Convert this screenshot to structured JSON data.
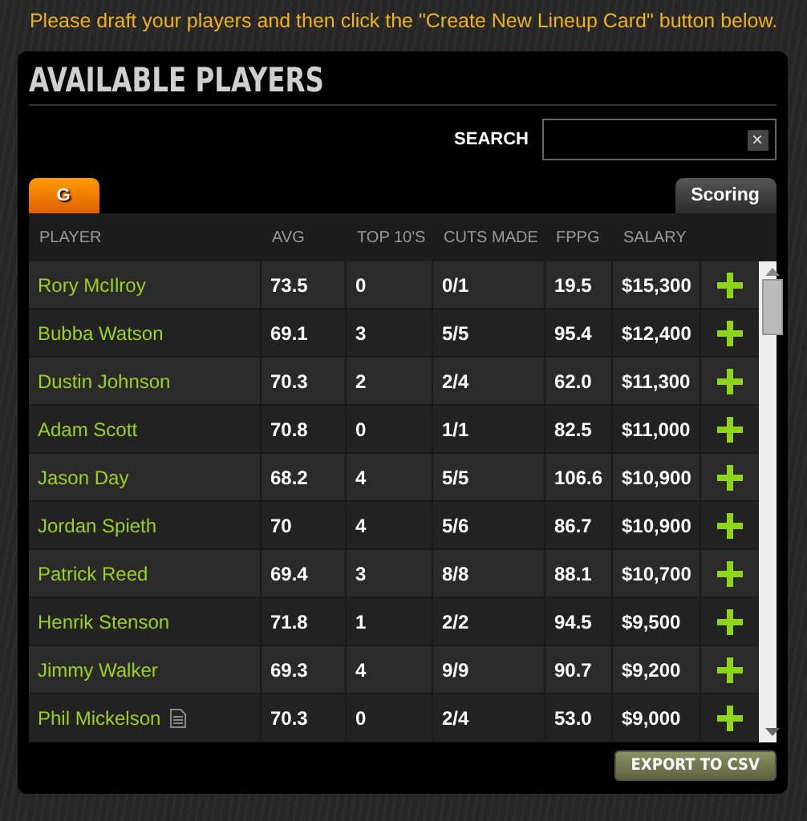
{
  "instruction": "Please draft your players and then click the \"Create New Lineup Card\" button below.",
  "panel": {
    "title": "AVAILABLE PLAYERS"
  },
  "search": {
    "label": "SEARCH",
    "clear": "×"
  },
  "tabs": [
    {
      "label": "G",
      "selected": true
    }
  ],
  "scoring_button": "Scoring",
  "table": {
    "columns": [
      "PLAYER",
      "AVG",
      "TOP 10'S",
      "CUTS MADE",
      "FPPG",
      "SALARY"
    ],
    "rows": [
      {
        "player": "Rory McIlroy",
        "note": false,
        "avg": "73.5",
        "top10": "0",
        "cuts": "0/1",
        "fppg": "19.5",
        "salary": "$15,300"
      },
      {
        "player": "Bubba Watson",
        "note": false,
        "avg": "69.1",
        "top10": "3",
        "cuts": "5/5",
        "fppg": "95.4",
        "salary": "$12,400"
      },
      {
        "player": "Dustin Johnson",
        "note": false,
        "avg": "70.3",
        "top10": "2",
        "cuts": "2/4",
        "fppg": "62.0",
        "salary": "$11,300"
      },
      {
        "player": "Adam Scott",
        "note": false,
        "avg": "70.8",
        "top10": "0",
        "cuts": "1/1",
        "fppg": "82.5",
        "salary": "$11,000"
      },
      {
        "player": "Jason Day",
        "note": false,
        "avg": "68.2",
        "top10": "4",
        "cuts": "5/5",
        "fppg": "106.6",
        "salary": "$10,900"
      },
      {
        "player": "Jordan Spieth",
        "note": false,
        "avg": "70",
        "top10": "4",
        "cuts": "5/6",
        "fppg": "86.7",
        "salary": "$10,900"
      },
      {
        "player": "Patrick Reed",
        "note": false,
        "avg": "69.4",
        "top10": "3",
        "cuts": "8/8",
        "fppg": "88.1",
        "salary": "$10,700"
      },
      {
        "player": "Henrik Stenson",
        "note": false,
        "avg": "71.8",
        "top10": "1",
        "cuts": "2/2",
        "fppg": "94.5",
        "salary": "$9,500"
      },
      {
        "player": "Jimmy Walker",
        "note": false,
        "avg": "69.3",
        "top10": "4",
        "cuts": "9/9",
        "fppg": "90.7",
        "salary": "$9,200"
      },
      {
        "player": "Phil Mickelson",
        "note": true,
        "avg": "70.3",
        "top10": "0",
        "cuts": "2/4",
        "fppg": "53.0",
        "salary": "$9,000"
      }
    ]
  },
  "export_button": "EXPORT TO CSV"
}
